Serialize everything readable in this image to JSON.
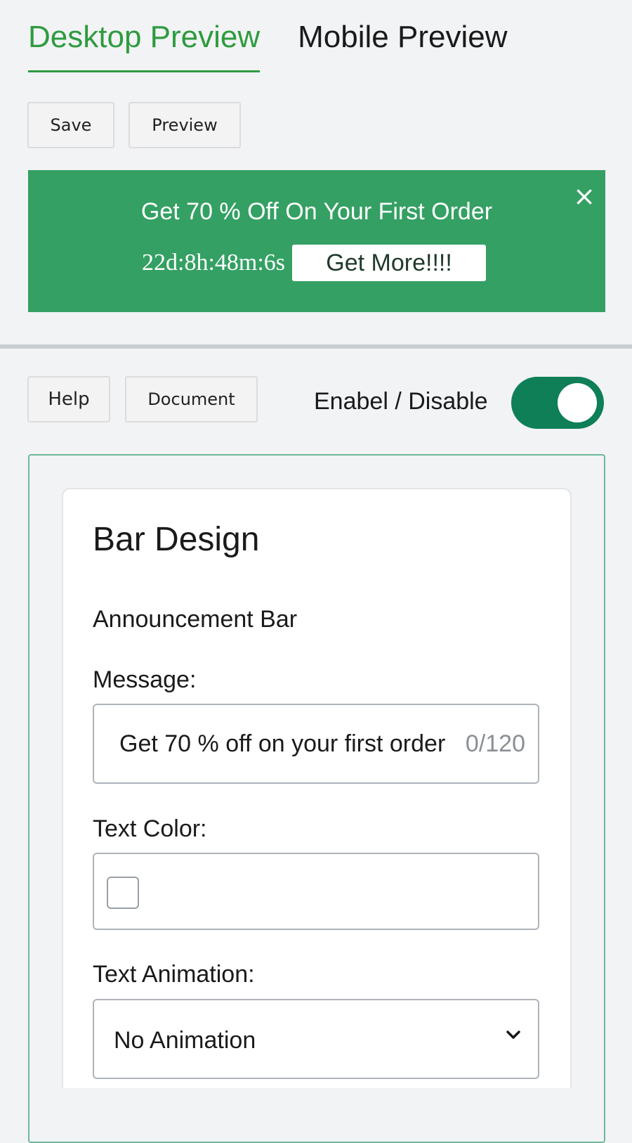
{
  "tabs": [
    {
      "label": "Desktop Preview",
      "active": true
    },
    {
      "label": "Mobile Preview",
      "active": false
    }
  ],
  "toolbar": {
    "save_label": "Save",
    "preview_label": "Preview"
  },
  "banner": {
    "title": "Get 70 % Off On Your First Order",
    "countdown": "22d:8h:48m:6s",
    "cta_label": "Get More!!!!",
    "close_icon": "×",
    "background": "#34a063"
  },
  "actions": {
    "help_label": "Help",
    "document_label": "Document"
  },
  "toggle": {
    "label": "Enabel / Disable",
    "enabled": true,
    "color": "#0e7f57"
  },
  "card": {
    "title": "Bar Design",
    "section": "Announcement Bar",
    "message": {
      "label": "Message:",
      "value": "Get 70 % off on your first order",
      "counter": "0/120"
    },
    "text_color": {
      "label": "Text Color:",
      "value": "#ffffff"
    },
    "text_animation": {
      "label": "Text Animation:",
      "selected": "No Animation",
      "icon": "chevron-down-icon"
    }
  },
  "colors": {
    "accent": "#2e9b3f",
    "card_border": "#6db89a"
  }
}
